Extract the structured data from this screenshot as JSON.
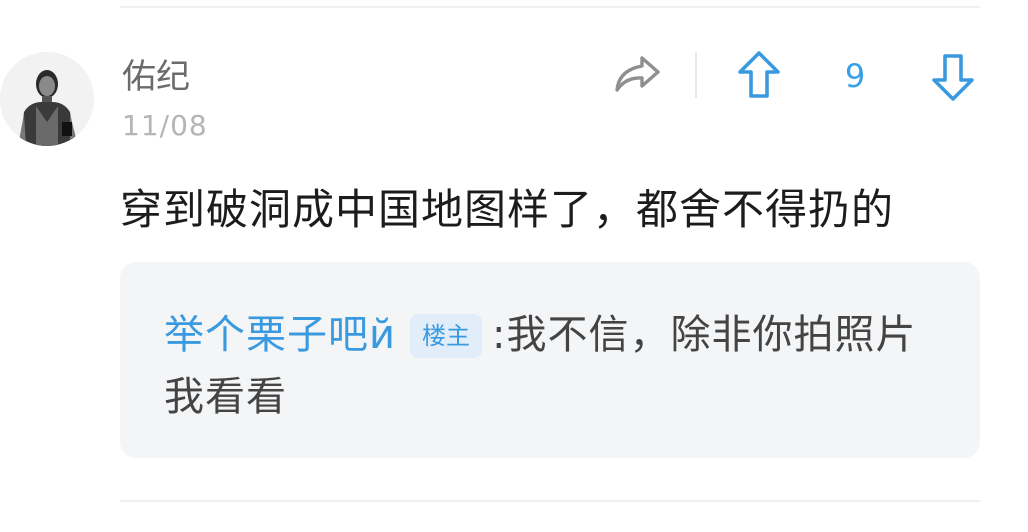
{
  "comment": {
    "username": "佑纪",
    "date": "11/08",
    "text": "穿到破洞成中国地图样了，都舍不得扔的"
  },
  "actions": {
    "share_icon": "share-arrow-icon",
    "upvote_icon": "arrow-up-icon",
    "vote_count": "9",
    "downvote_icon": "arrow-down-icon"
  },
  "reply": {
    "username": "举个栗子吧й",
    "badge": "楼主",
    "separator": ":",
    "text": "我不信，除非你拍照片我看看"
  },
  "colors": {
    "accent": "#3a9ae0",
    "username": "#6b6b6b",
    "date": "#b5b5b5",
    "quote_bg": "#f4f5f7"
  }
}
